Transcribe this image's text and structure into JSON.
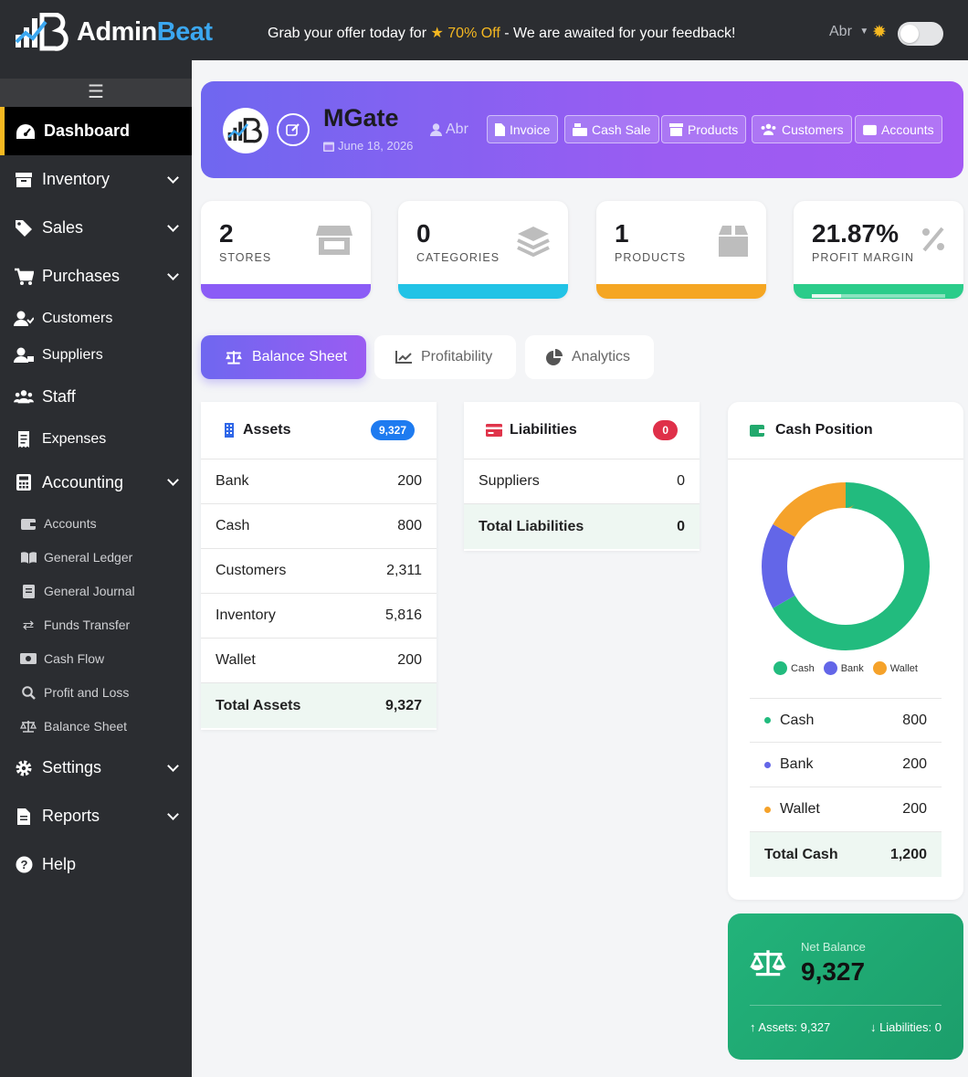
{
  "app": {
    "name_part1": "Admin",
    "name_part2": "Beat"
  },
  "topbar": {
    "promo_before": "Grab your offer today for",
    "promo_highlight": "70% Off",
    "promo_after": "- We are awaited for your feedback!",
    "user": "Abr"
  },
  "sidebar": {
    "menu_icon": "☰",
    "items": [
      {
        "label": "Dashboard",
        "icon": "gauge-icon"
      },
      {
        "label": "Inventory",
        "icon": "box-icon"
      },
      {
        "label": "Sales",
        "icon": "tag-icon"
      },
      {
        "label": "Purchases",
        "icon": "cart-icon"
      },
      {
        "label": "Customers",
        "icon": "user-icon"
      },
      {
        "label": "Suppliers",
        "icon": "user-icon"
      },
      {
        "label": "Staff",
        "icon": "users-icon"
      },
      {
        "label": "Expenses",
        "icon": "receipt-icon"
      },
      {
        "label": "Accounting",
        "icon": "calculator-icon"
      },
      {
        "label": "Settings",
        "icon": "gear-icon"
      },
      {
        "label": "Reports",
        "icon": "file-icon"
      },
      {
        "label": "Help",
        "icon": "question-icon"
      }
    ],
    "accounting_sub": [
      {
        "label": "Accounts",
        "icon": "wallet-icon"
      },
      {
        "label": "General Ledger",
        "icon": "book-icon"
      },
      {
        "label": "General Journal",
        "icon": "journal-icon"
      },
      {
        "label": "Funds Transfer",
        "icon": "exchange-icon"
      },
      {
        "label": "Cash Flow",
        "icon": "money-icon"
      },
      {
        "label": "Profit and Loss",
        "icon": "search-dollar-icon"
      },
      {
        "label": "Balance Sheet",
        "icon": "scale-icon"
      }
    ]
  },
  "header": {
    "title": "MGate",
    "date": "June 18, 2026",
    "user": "Abr",
    "buttons": [
      "Invoice",
      "Cash Sale",
      "Products",
      "Customers",
      "Accounts"
    ]
  },
  "stats": [
    {
      "value": "2",
      "label": "STORES",
      "color": "#8b5cf6"
    },
    {
      "value": "0",
      "label": "CATEGORIES",
      "color": "#22c3e6"
    },
    {
      "value": "1",
      "label": "PRODUCTS",
      "color": "#f5a623"
    },
    {
      "value": "21.87%",
      "label": "PROFIT MARGIN",
      "color": "#2bcc8a",
      "progress": 0.2187
    }
  ],
  "tabs": [
    "Balance Sheet",
    "Profitability",
    "Analytics"
  ],
  "assets": {
    "title": "Assets",
    "badge": "9,327",
    "rows": [
      {
        "name": "Bank",
        "value": "200"
      },
      {
        "name": "Cash",
        "value": "800"
      },
      {
        "name": "Customers",
        "value": "2,311"
      },
      {
        "name": "Inventory",
        "value": "5,816"
      },
      {
        "name": "Wallet",
        "value": "200"
      }
    ],
    "total_label": "Total Assets",
    "total_value": "9,327"
  },
  "liabilities": {
    "title": "Liabilities",
    "badge": "0",
    "rows": [
      {
        "name": "Suppliers",
        "value": "0"
      }
    ],
    "total_label": "Total Liabilities",
    "total_value": "0"
  },
  "cash_position": {
    "title": "Cash Position",
    "rows": [
      {
        "name": "Cash",
        "value": "800"
      },
      {
        "name": "Bank",
        "value": "200"
      },
      {
        "name": "Wallet",
        "value": "200"
      }
    ],
    "total_label": "Total Cash",
    "total_value": "1,200"
  },
  "chart_data": {
    "type": "pie",
    "categories": [
      "Cash",
      "Bank",
      "Wallet"
    ],
    "values": [
      800,
      200,
      200
    ],
    "colors": [
      "#22bb7e",
      "#6366e8",
      "#f5a22a"
    ],
    "legend": "bottom"
  },
  "net_balance": {
    "label": "Net Balance",
    "value": "9,327",
    "assets": "Assets: 9,327",
    "liabilities": "Liabilities: 0"
  }
}
